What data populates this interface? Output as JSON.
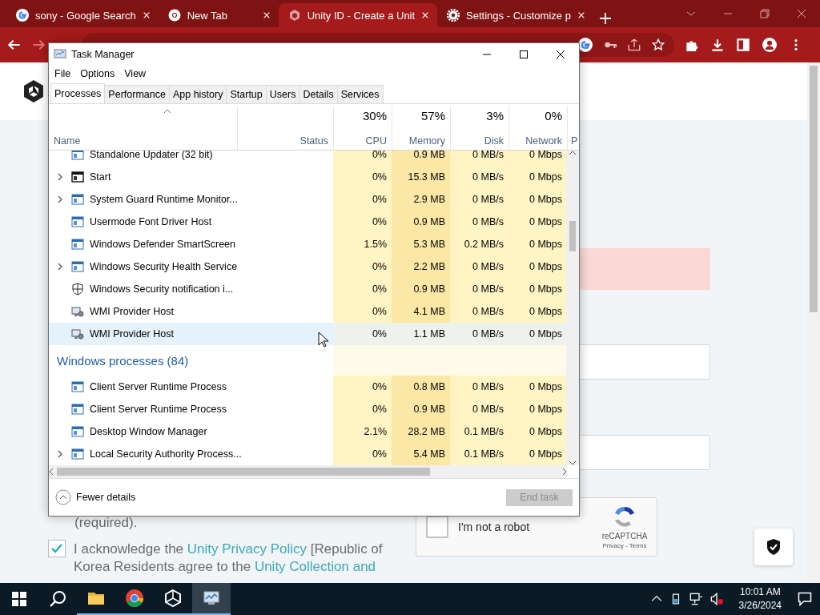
{
  "browser": {
    "tabs": [
      {
        "title": "sony - Google Search",
        "selected": false
      },
      {
        "title": "New Tab",
        "selected": false
      },
      {
        "title": "Unity ID - Create a Unit",
        "selected": true
      },
      {
        "title": "Settings - Customize p",
        "selected": false
      }
    ]
  },
  "page": {
    "required_note": "(required).",
    "consent": {
      "checked": true,
      "parts": [
        {
          "text": "I acknowledge the ",
          "link": false
        },
        {
          "text": "Unity Privacy Policy",
          "link": true
        },
        {
          "text": " [Republic of Korea Residents agree to the ",
          "link": false
        },
        {
          "text": "Unity Collection and",
          "link": true
        }
      ]
    },
    "captcha": {
      "label": "I'm not a robot",
      "checked": false,
      "brand": "reCAPTCHA",
      "links": "Privacy - Terms"
    }
  },
  "task_manager": {
    "title": "Task Manager",
    "menu": [
      "File",
      "Options",
      "View"
    ],
    "tabs": [
      {
        "label": "Processes",
        "selected": true
      },
      {
        "label": "Performance",
        "selected": false
      },
      {
        "label": "App history",
        "selected": false
      },
      {
        "label": "Startup",
        "selected": false
      },
      {
        "label": "Users",
        "selected": false
      },
      {
        "label": "Details",
        "selected": false
      },
      {
        "label": "Services",
        "selected": false
      }
    ],
    "columns": [
      {
        "label": "Name"
      },
      {
        "label": "Status"
      },
      {
        "usage": "30%",
        "label": "CPU"
      },
      {
        "usage": "57%",
        "label": "Memory"
      },
      {
        "usage": "3%",
        "label": "Disk"
      },
      {
        "usage": "0%",
        "label": "Network"
      },
      {
        "label": "P"
      }
    ],
    "rows": [
      {
        "kind": "app",
        "name": "Standalone Updater (32 bit)",
        "expandable": false,
        "selected": false,
        "cpu": "0%",
        "memory": "0.9 MB",
        "disk": "0 MB/s",
        "network": "0 Mbps"
      },
      {
        "kind": "start",
        "name": "Start",
        "expandable": true,
        "selected": false,
        "cpu": "0%",
        "memory": "15.3 MB",
        "disk": "0 MB/s",
        "network": "0 Mbps"
      },
      {
        "kind": "app",
        "name": "System Guard Runtime Monitor...",
        "expandable": true,
        "selected": false,
        "cpu": "0%",
        "memory": "2.9 MB",
        "disk": "0 MB/s",
        "network": "0 Mbps"
      },
      {
        "kind": "app",
        "name": "Usermode Font Driver Host",
        "expandable": false,
        "selected": false,
        "cpu": "0%",
        "memory": "0.9 MB",
        "disk": "0 MB/s",
        "network": "0 Mbps"
      },
      {
        "kind": "app",
        "name": "Windows Defender SmartScreen",
        "expandable": false,
        "selected": false,
        "cpu": "1.5%",
        "memory": "5.3 MB",
        "disk": "0.2 MB/s",
        "network": "0 Mbps"
      },
      {
        "kind": "app",
        "name": "Windows Security Health Service",
        "expandable": true,
        "selected": false,
        "cpu": "0%",
        "memory": "2.2 MB",
        "disk": "0 MB/s",
        "network": "0 Mbps"
      },
      {
        "kind": "shield",
        "name": "Windows Security notification i...",
        "expandable": false,
        "selected": false,
        "cpu": "0%",
        "memory": "0.9 MB",
        "disk": "0 MB/s",
        "network": "0 Mbps"
      },
      {
        "kind": "wmi",
        "name": "WMI Provider Host",
        "expandable": false,
        "selected": false,
        "cpu": "0%",
        "memory": "4.1 MB",
        "disk": "0 MB/s",
        "network": "0 Mbps"
      },
      {
        "kind": "wmi",
        "name": "WMI Provider Host",
        "expandable": false,
        "selected": true,
        "cpu": "0%",
        "memory": "1.1 MB",
        "disk": "0 MB/s",
        "network": "0 Mbps"
      },
      {
        "kind": "group",
        "name": "Windows processes (84)"
      },
      {
        "kind": "app",
        "name": "Client Server Runtime Process",
        "expandable": false,
        "selected": false,
        "cpu": "0%",
        "memory": "0.8 MB",
        "disk": "0 MB/s",
        "network": "0 Mbps"
      },
      {
        "kind": "app",
        "name": "Client Server Runtime Process",
        "expandable": false,
        "selected": false,
        "cpu": "0%",
        "memory": "0.9 MB",
        "disk": "0 MB/s",
        "network": "0 Mbps"
      },
      {
        "kind": "app",
        "name": "Desktop Window Manager",
        "expandable": false,
        "selected": false,
        "cpu": "2.1%",
        "memory": "28.2 MB",
        "disk": "0.1 MB/s",
        "network": "0 Mbps"
      },
      {
        "kind": "app",
        "name": "Local Security Authority Process...",
        "expandable": true,
        "selected": false,
        "cpu": "0%",
        "memory": "5.4 MB",
        "disk": "0.1 MB/s",
        "network": "0 Mbps"
      }
    ],
    "footer": {
      "toggle": "Fewer details",
      "end_task": {
        "label": "End task",
        "disabled": true
      }
    }
  },
  "taskbar": {
    "apps": [
      {
        "selected": false
      },
      {
        "selected": false
      },
      {
        "selected": false
      },
      {
        "selected": true
      }
    ],
    "time": "10:01 AM",
    "date": "3/26/2024"
  }
}
